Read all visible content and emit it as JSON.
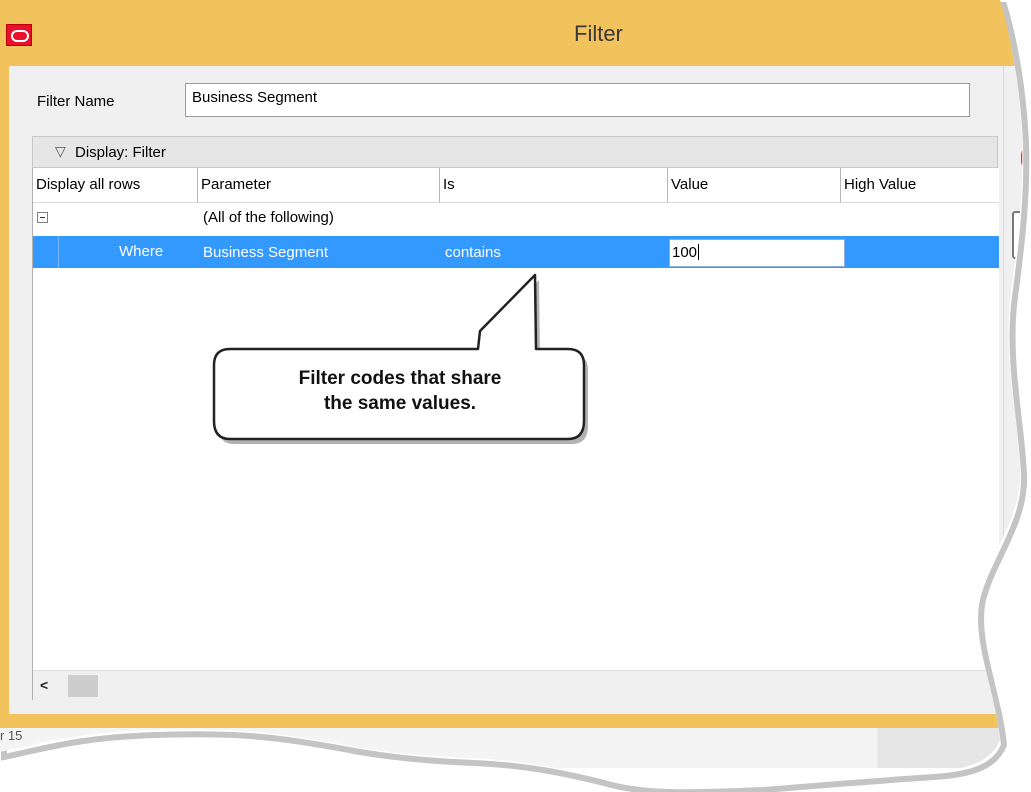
{
  "window": {
    "title": "Filter",
    "icon": "oracle-logo-icon"
  },
  "filter_name": {
    "label": "Filter Name",
    "value": "Business Segment"
  },
  "display_section": {
    "label": "Display: Filter",
    "icon": "chevron-down-icon"
  },
  "grid": {
    "columns": [
      "Display all rows",
      "Parameter",
      "Is",
      "Value",
      "High Value"
    ],
    "group_label": "(All of the following)",
    "row": {
      "where": "Where",
      "parameter": "Business Segment",
      "operator": "contains",
      "value": "100",
      "high_value": ""
    }
  },
  "callout": {
    "line1": "Filter codes that share",
    "line2": "the same values."
  },
  "status": {
    "text": "r 15"
  },
  "colors": {
    "title_bar": "#f2c35c",
    "selection": "#3399ff",
    "app_icon": "#e8112d"
  }
}
